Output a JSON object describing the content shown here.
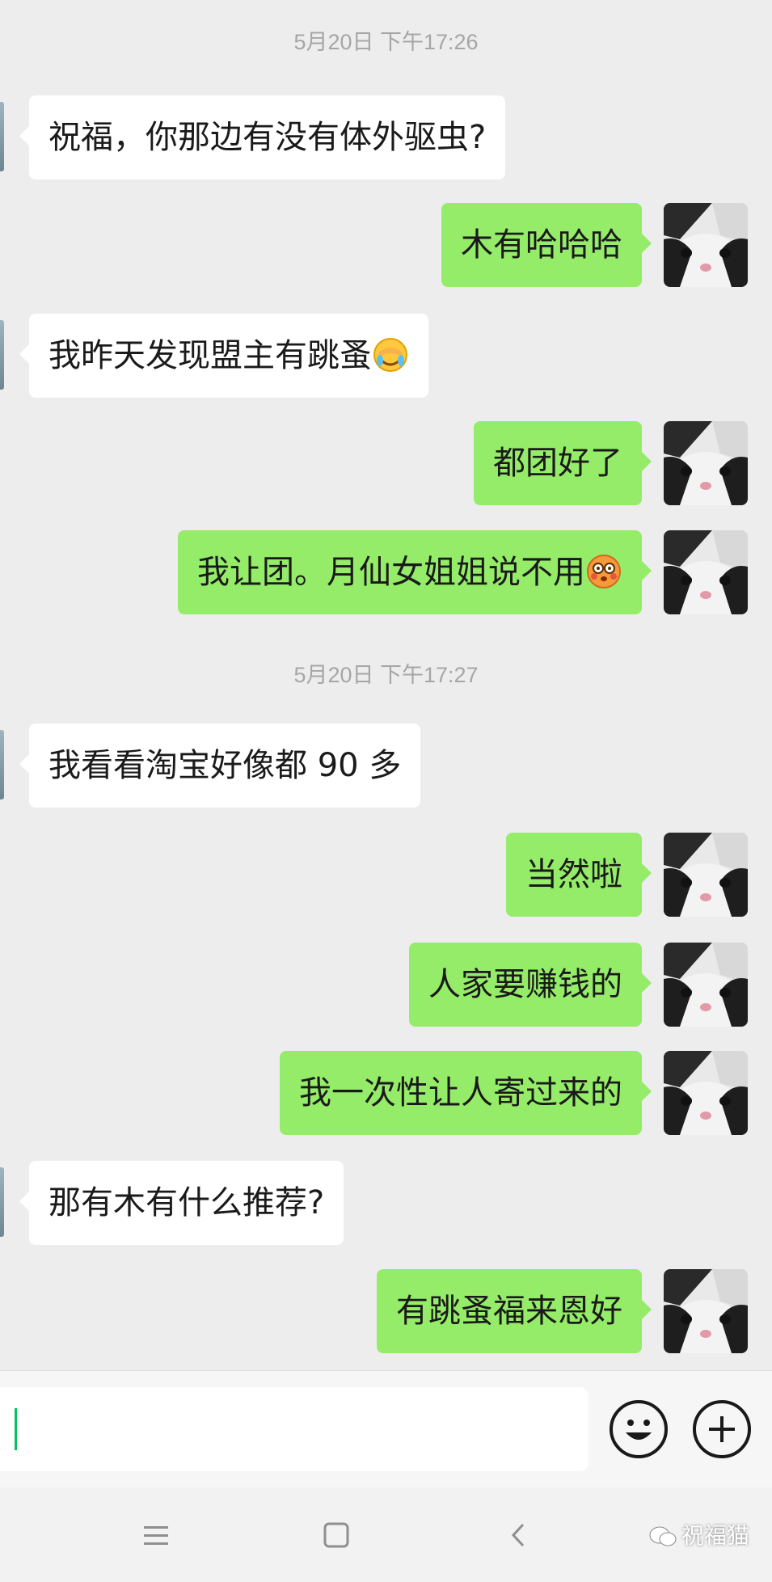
{
  "conversation": {
    "timestamps": [
      "5月20日 下午17:26",
      "5月20日 下午17:27"
    ],
    "messages": [
      {
        "side": "left",
        "text": "祝福，你那边有没有体外驱虫?"
      },
      {
        "side": "right",
        "text": "木有哈哈哈"
      },
      {
        "side": "left",
        "text": "我昨天发现盟主有跳蚤",
        "emoji": "facepalm-crying-emoji"
      },
      {
        "side": "right",
        "text": "都团好了"
      },
      {
        "side": "right",
        "text": "我让团。月仙女姐姐说不用",
        "emoji": "flushed-face-emoji"
      },
      {
        "side": "left",
        "text": "我看看淘宝好像都 90 多"
      },
      {
        "side": "right",
        "text": "当然啦"
      },
      {
        "side": "right",
        "text": "人家要赚钱的"
      },
      {
        "side": "right",
        "text": "我一次性让人寄过来的"
      },
      {
        "side": "left",
        "text": "那有木有什么推荐?"
      },
      {
        "side": "right",
        "text": "有跳蚤福来恩好"
      }
    ]
  },
  "input_bar": {
    "value": "",
    "icons": [
      "emoji-icon",
      "plus-icon"
    ]
  },
  "nav_bar": {
    "icons": [
      "menu-icon",
      "home-square-icon",
      "back-chevron-icon"
    ]
  },
  "watermark": {
    "text": "祝福猫",
    "icon": "wechat-bubble-icon"
  },
  "colors": {
    "background": "#ededed",
    "own_bubble": "#95ec69",
    "peer_bubble": "#ffffff",
    "caret": "#07c160"
  }
}
